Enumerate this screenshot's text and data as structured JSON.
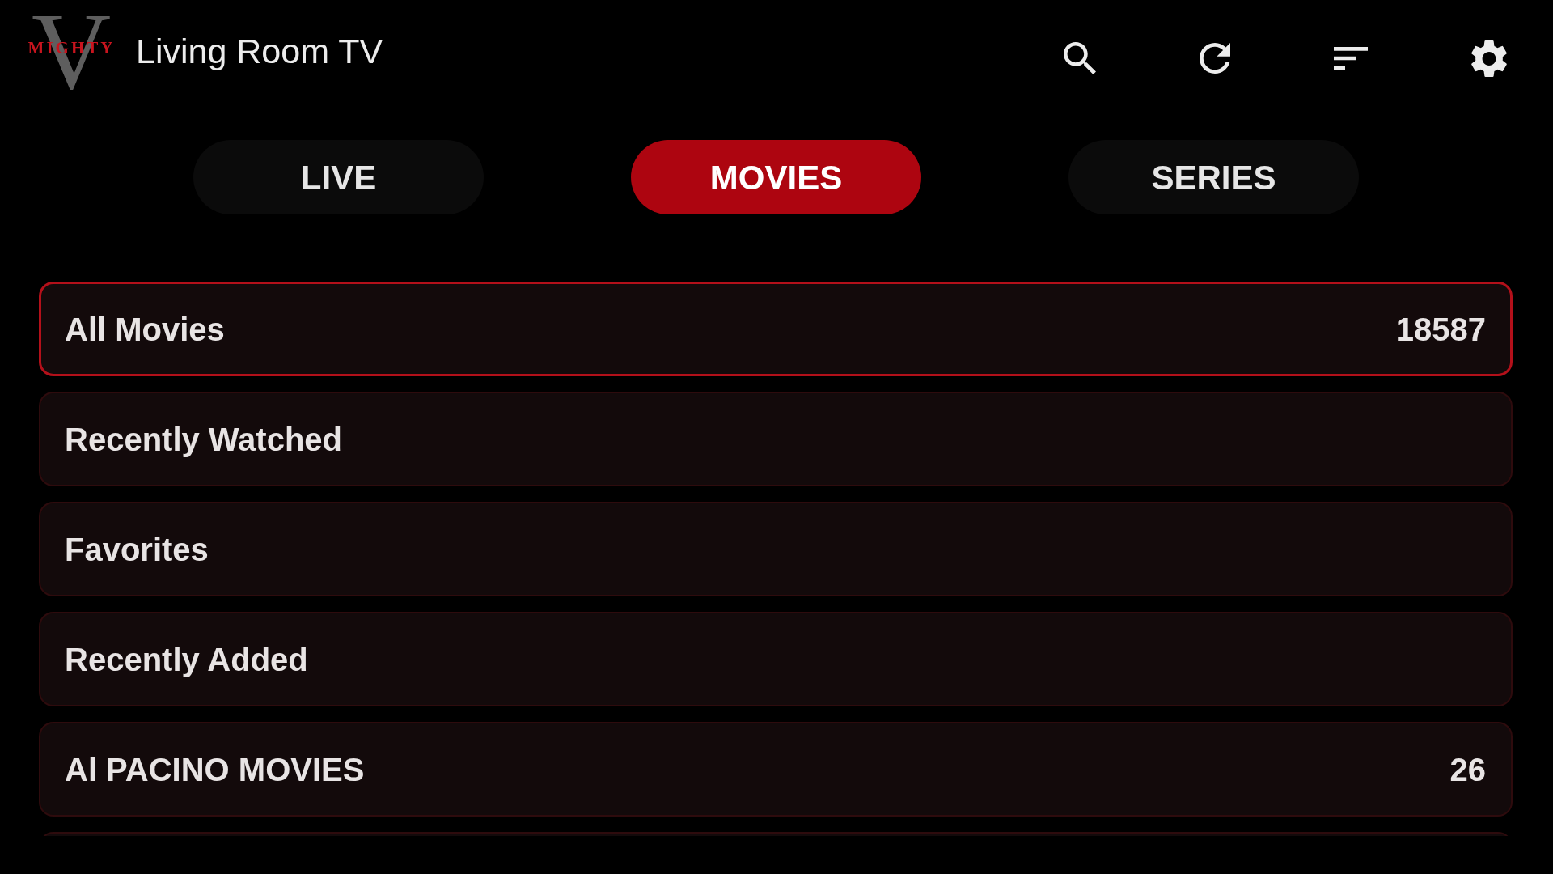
{
  "header": {
    "logo": {
      "wordmark": "MIGHTY",
      "letter": "V"
    },
    "title": "Living Room TV",
    "actions": [
      {
        "kind": "search"
      },
      {
        "kind": "refresh"
      },
      {
        "kind": "sort"
      },
      {
        "kind": "settings"
      }
    ]
  },
  "tabs": [
    {
      "label": "LIVE",
      "selected": false
    },
    {
      "label": "MOVIES",
      "selected": true
    },
    {
      "label": "SERIES",
      "selected": false
    }
  ],
  "categories": [
    {
      "name": "All Movies",
      "count": "18587",
      "selected": true
    },
    {
      "name": "Recently Watched",
      "selected": false
    },
    {
      "name": "Favorites",
      "selected": false
    },
    {
      "name": "Recently Added",
      "selected": false
    },
    {
      "name": "Al PACINO MOVIES",
      "count": "26",
      "selected": false
    }
  ]
}
